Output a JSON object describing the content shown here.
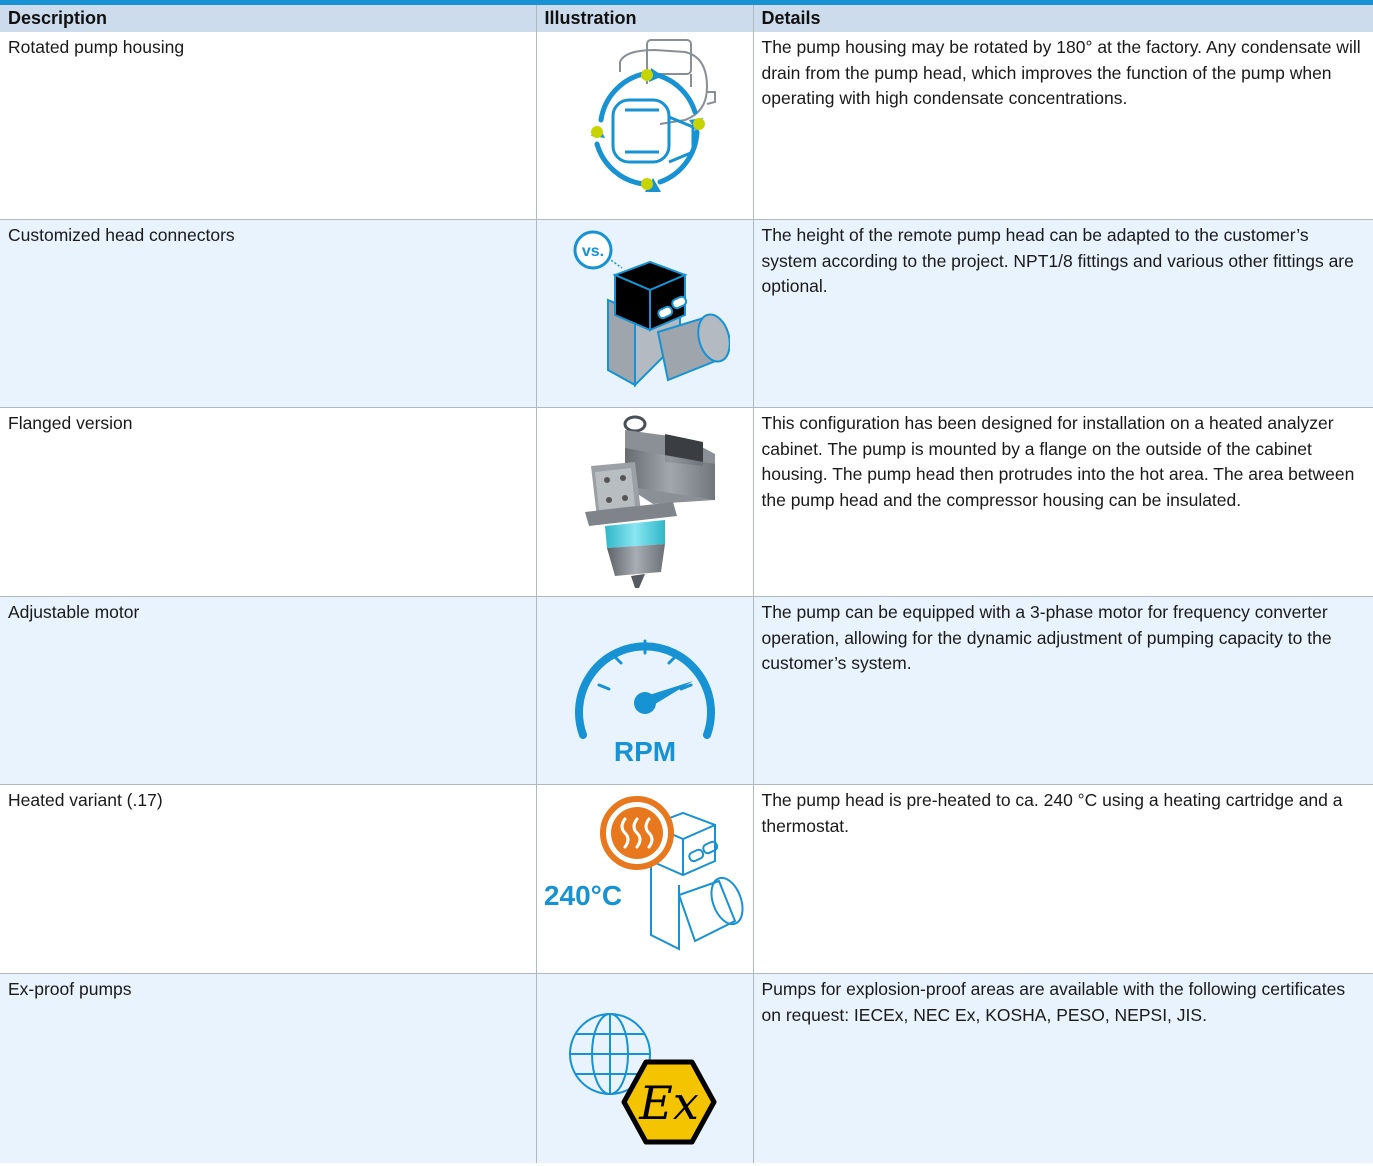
{
  "header": {
    "description": "Description",
    "illustration": "Illustration",
    "details": "Details"
  },
  "rows": [
    {
      "description": "Rotated pump housing",
      "icon": "rotated-pump-housing-icon",
      "details": "The pump housing may be rotated by 180° at the factory. Any condensate will drain from the pump head, which improves the function of the pump when operating with high condensate concentrations."
    },
    {
      "description": "Customized head connectors",
      "icon": "custom-head-connectors-icon",
      "icon_text": "vs.",
      "details": "The height of the remote pump head can be adapted to the customer’s system according to the project. NPT1/8 fittings and various other fittings are optional."
    },
    {
      "description": "Flanged version",
      "icon": "flanged-pump-image",
      "details": "This configuration has been designed for installation on a heated analyzer cabinet. The pump is mounted by a flange on the outside of the cabinet housing. The pump head then protrudes into the hot area. The area between the pump head and the compressor housing can be insulated."
    },
    {
      "description": "Adjustable motor",
      "icon": "rpm-gauge-icon",
      "icon_text": "RPM",
      "details": "The pump can be equipped with a 3-phase motor for frequency converter operation, allowing for the dynamic adjustment of pumping capacity to the customer’s system."
    },
    {
      "description": "Heated variant (.17)",
      "icon": "heated-pump-icon",
      "icon_text": "240°C",
      "details": "The pump head is pre-heated to ca. 240 °C using a heating cartridge and a thermostat."
    },
    {
      "description": "Ex-proof pumps",
      "icon": "ex-proof-globe-icon",
      "icon_text": "Ex",
      "details": "Pumps for explosion-proof areas are available with the following certificates on request: IECEx, NEC Ex, KOSHA, PESO, NEPSI, JIS."
    }
  ],
  "colors": {
    "accent_blue": "#1792d2",
    "header_bg": "#ccdcec",
    "alt_row_bg": "#e8f3fd",
    "dot_green": "#c8d400",
    "heat_orange": "#e8781e",
    "ex_yellow": "#f5c400"
  }
}
